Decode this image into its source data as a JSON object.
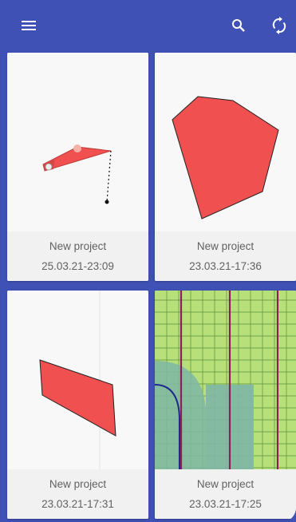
{
  "appbar": {
    "icons": {
      "menu": "menu-icon",
      "search": "search-icon",
      "sync": "sync-icon"
    },
    "color": "#3f51b5"
  },
  "projects": [
    {
      "name": "New project",
      "date": "25.03.21-23:09",
      "thumbnail": "polygon-with-measure-line"
    },
    {
      "name": "New project",
      "date": "23.03.21-17:36",
      "thumbnail": "red-hexagon"
    },
    {
      "name": "New project",
      "date": "23.03.21-17:31",
      "thumbnail": "red-parallelogram"
    },
    {
      "name": "New project",
      "date": "23.03.21-17:25",
      "thumbnail": "field-grid-map"
    }
  ],
  "colors": {
    "shape_fill": "#f05050",
    "field_green": "#b7e07a",
    "path_purple": "#8a1f5a",
    "overlay_teal": "#7fb6a6"
  }
}
